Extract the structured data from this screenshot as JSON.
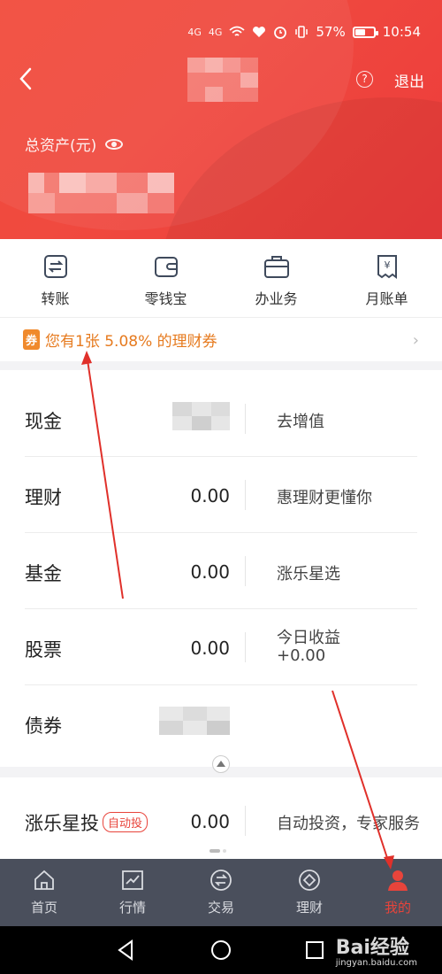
{
  "status": {
    "net1": "4G",
    "net2": "4G",
    "battery": "57%",
    "time": "10:54",
    "battery_level": 0.57
  },
  "header": {
    "logout": "退出",
    "help": "?",
    "total_assets_label": "总资产(元)"
  },
  "actions": [
    {
      "label": "转账",
      "icon": "transfer-icon"
    },
    {
      "label": "零钱宝",
      "icon": "wallet-icon"
    },
    {
      "label": "办业务",
      "icon": "briefcase-icon"
    },
    {
      "label": "月账单",
      "icon": "bill-icon"
    }
  ],
  "coupon": {
    "tag": "券",
    "text": "您有1张 5.08% 的理财券"
  },
  "assets": [
    {
      "name": "现金",
      "value": "",
      "desc": "去增值"
    },
    {
      "name": "理财",
      "value": "0.00",
      "desc": "惠理财更懂你"
    },
    {
      "name": "基金",
      "value": "0.00",
      "desc": "涨乐星选"
    },
    {
      "name": "股票",
      "value": "0.00",
      "desc_label": "今日收益",
      "desc": "+0.00"
    },
    {
      "name": "债券",
      "value": "",
      "desc": ""
    }
  ],
  "star_invest": {
    "name": "涨乐星投",
    "tag": "自动投",
    "value": "0.00",
    "desc": "自动投资，专家服务"
  },
  "tabs": [
    {
      "label": "首页",
      "icon": "home-icon"
    },
    {
      "label": "行情",
      "icon": "chart-icon"
    },
    {
      "label": "交易",
      "icon": "exchange-icon"
    },
    {
      "label": "理财",
      "icon": "diamond-icon"
    },
    {
      "label": "我的",
      "icon": "person-icon",
      "active": true
    }
  ],
  "watermark": {
    "brand": "Bai经验",
    "url": "jingyan.baidu.com"
  },
  "colors": {
    "header_red": "#f04a3f",
    "accent_red": "#e8443b",
    "coupon_orange": "#e67a1e",
    "tabbar": "#4a4f5c"
  }
}
